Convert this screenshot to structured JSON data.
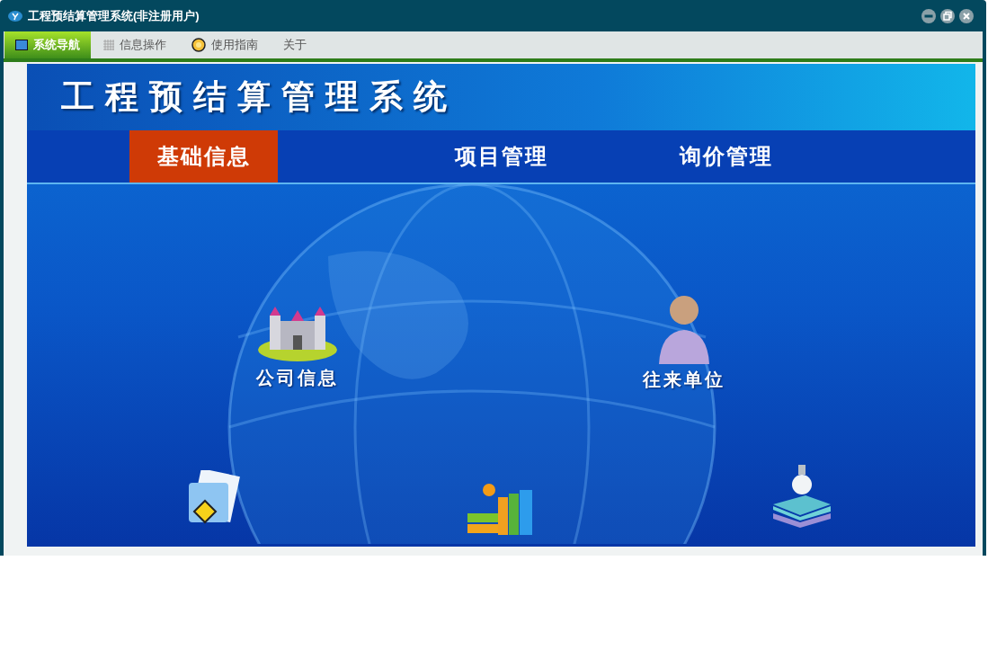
{
  "window": {
    "title": "工程预结算管理系统(非注册用户)"
  },
  "menu_tabs": [
    {
      "label": "系统导航",
      "selected": true
    },
    {
      "label": "信息操作",
      "selected": false
    },
    {
      "label": "使用指南",
      "selected": false
    },
    {
      "label": "关于",
      "selected": false
    }
  ],
  "banner": {
    "title": "工程预结算管理系统"
  },
  "nav_tabs": [
    {
      "label": "基础信息",
      "selected": true
    },
    {
      "label": "项目管理",
      "selected": false
    },
    {
      "label": "询价管理",
      "selected": false
    }
  ],
  "modules": [
    {
      "label": "公司信息"
    },
    {
      "label": "往来单位"
    }
  ]
}
